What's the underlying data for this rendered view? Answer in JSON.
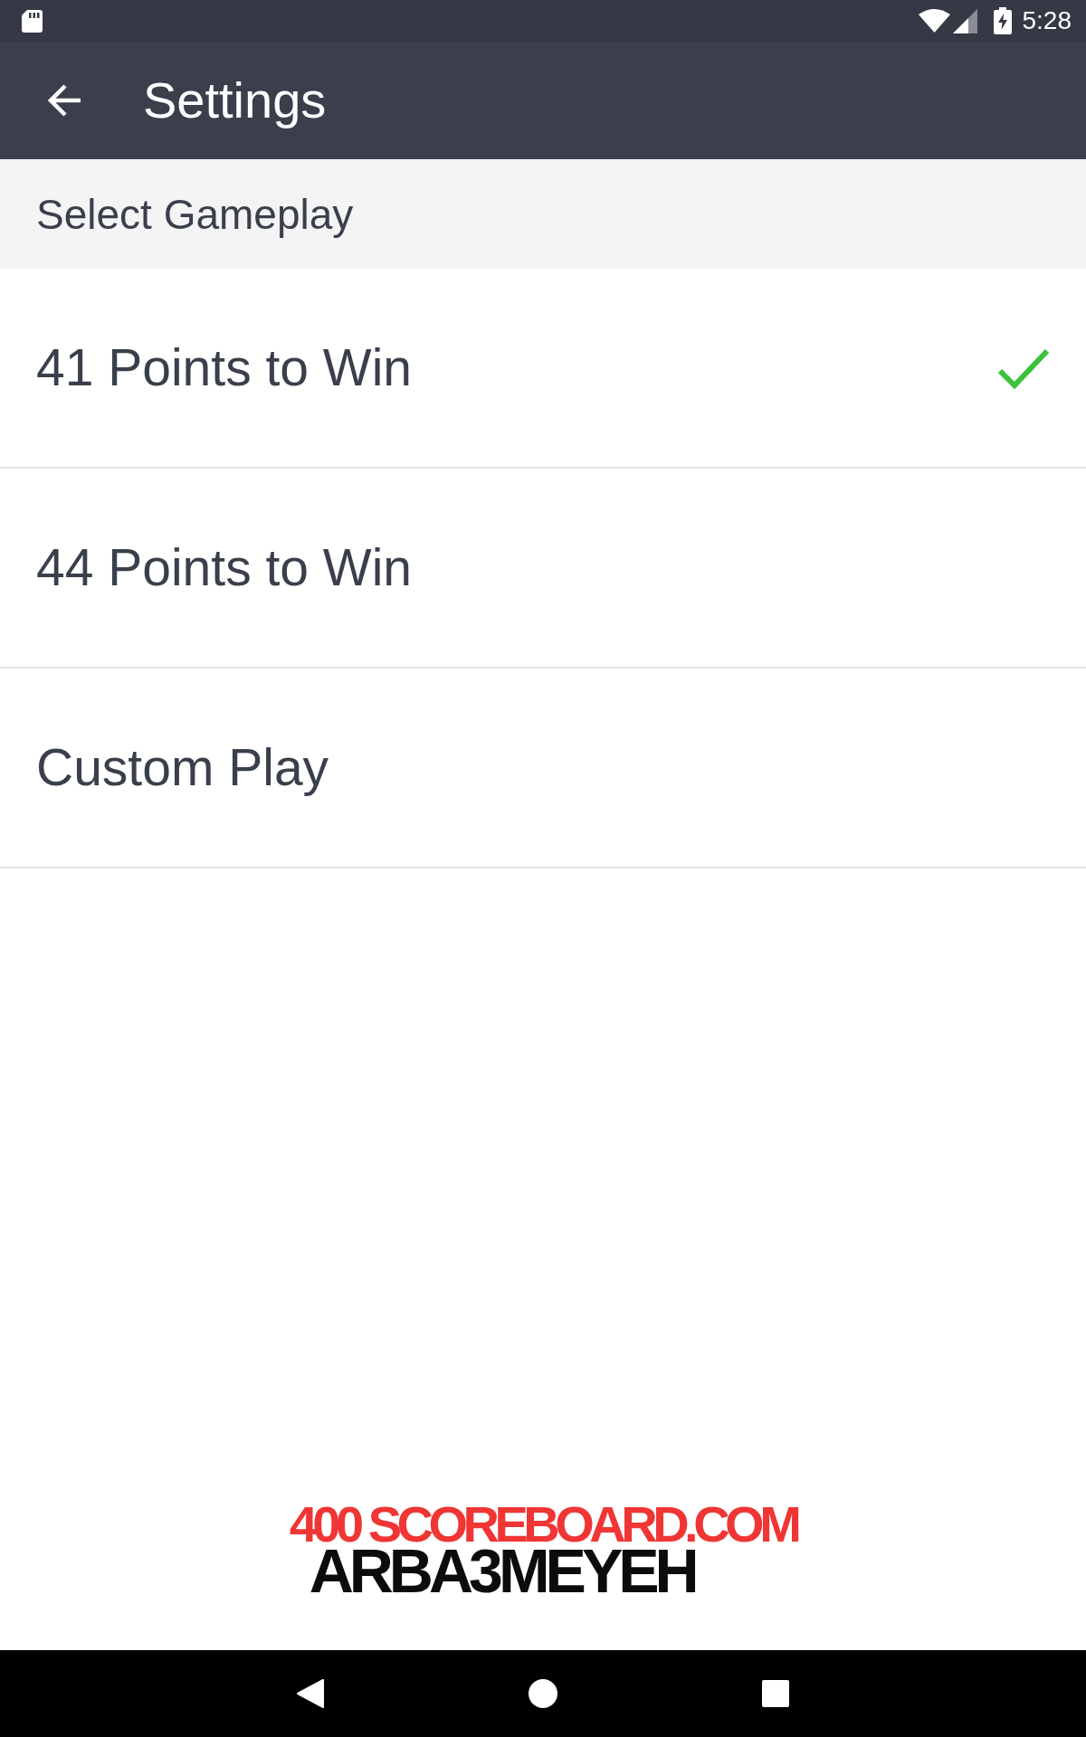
{
  "status_bar": {
    "time": "5:28"
  },
  "app_bar": {
    "title": "Settings"
  },
  "section": {
    "title": "Select Gameplay"
  },
  "options": [
    {
      "label": "41 Points to Win",
      "selected": true
    },
    {
      "label": "44 Points to Win",
      "selected": false
    },
    {
      "label": "Custom Play",
      "selected": false
    }
  ],
  "footer_logo": {
    "line_1": "400 SCOREBOARD.COM",
    "line_2": "ARBA3MEYEH"
  }
}
